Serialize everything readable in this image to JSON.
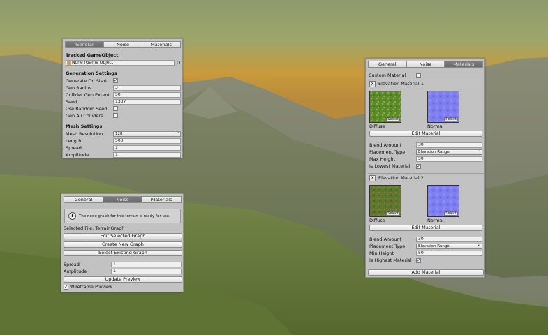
{
  "colors": {
    "panel_bg": "#c2c2c2",
    "tab_active": "#6f6f6f",
    "check_blue": "#1f3f8a"
  },
  "top_panel": {
    "tabs": [
      "General",
      "Noise",
      "Materials"
    ],
    "active_tab": "General",
    "tracked_header": "Tracked GameObject",
    "tracked_value": "None (Game Object)",
    "gen_header": "Generation Settings",
    "generate_on_start_label": "Generate On Start",
    "generate_on_start_checked": true,
    "gen_radius_label": "Gen Radius",
    "gen_radius_value": "3",
    "collider_extent_label": "Collider Gen Extent",
    "collider_extent_value": "50",
    "seed_label": "Seed",
    "seed_value": "1337",
    "use_random_seed_label": "Use Random Seed",
    "use_random_seed_checked": false,
    "gen_all_colliders_label": "Gen All Colliders",
    "gen_all_colliders_checked": false,
    "mesh_header": "Mesh Settings",
    "mesh_resolution_label": "Mesh Resolution",
    "mesh_resolution_value": "128",
    "length_label": "Length",
    "length_value": "500",
    "spread_label": "Spread",
    "spread_value": "1",
    "amplitude_label": "Amplitude",
    "amplitude_value": "1"
  },
  "noise_panel": {
    "tabs": [
      "General",
      "Noise",
      "Materials"
    ],
    "active_tab": "Noise",
    "info_icon": "info-icon",
    "info_text": "The node graph for this terrain is ready for use.",
    "selected_file": "Selected File: TerrainGraph",
    "edit_graph_button": "Edit Selected Graph",
    "create_graph_button": "Create New Graph",
    "select_graph_button": "Select Existing Graph",
    "spread_label": "Spread",
    "spread_value": "1",
    "amplitude_label": "Amplitude",
    "amplitude_value": "1",
    "update_preview_button": "Update Preview",
    "wireframe_label": "Wireframe Preview",
    "wireframe_checked": true
  },
  "materials_panel": {
    "tabs": [
      "General",
      "Noise",
      "Materials"
    ],
    "active_tab": "Materials",
    "custom_material_label": "Custom Material",
    "custom_material_checked": false,
    "mat1": {
      "remove_label": "X",
      "title": "Elevation Material 1",
      "diffuse_label": "Diffuse",
      "normal_label": "Normal",
      "select_label": "Select",
      "edit_button": "Edit Material",
      "blend_label": "Blend Amount",
      "blend_value": "30",
      "placement_label": "Placement Type",
      "placement_value": "Elevation Range",
      "height_label": "Max Height",
      "height_value": "50",
      "flag_label": "Is Lowest Material",
      "flag_checked": true
    },
    "mat2": {
      "remove_label": "X",
      "title": "Elevation Material 2",
      "diffuse_label": "Diffuse",
      "normal_label": "Normal",
      "select_label": "Select",
      "edit_button": "Edit Material",
      "blend_label": "Blend Amount",
      "blend_value": "30",
      "placement_label": "Placement Type",
      "placement_value": "Elevation Range",
      "height_label": "Min Height",
      "height_value": "50",
      "flag_label": "Is Highest Material",
      "flag_checked": true
    },
    "add_button": "Add Material"
  }
}
